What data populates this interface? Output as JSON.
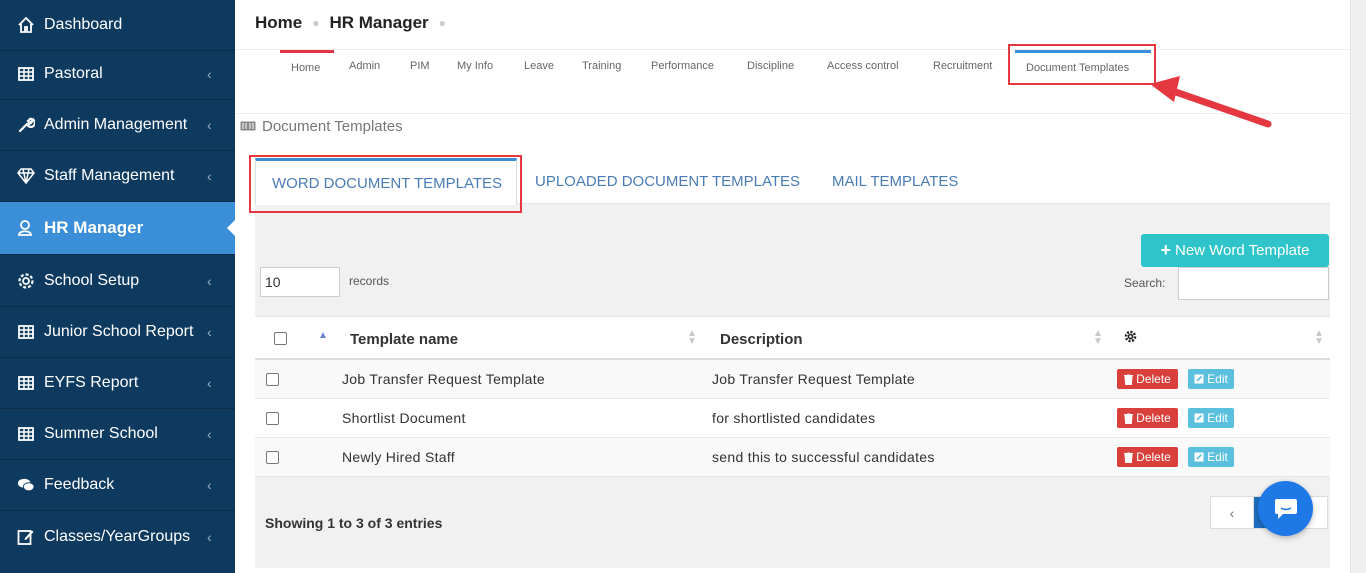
{
  "sidebar": {
    "items": [
      {
        "label": "Dashboard",
        "icon": "home-icon",
        "chevron": false
      },
      {
        "label": "Pastoral",
        "icon": "grid-icon",
        "chevron": true
      },
      {
        "label": "Admin Management",
        "icon": "wrench-icon",
        "chevron": true
      },
      {
        "label": "Staff Management",
        "icon": "diamond-icon",
        "chevron": true
      },
      {
        "label": "HR Manager",
        "icon": "user-hr-icon",
        "chevron": false,
        "active": true
      },
      {
        "label": "School Setup",
        "icon": "gear-icon",
        "chevron": true
      },
      {
        "label": "Junior School Report",
        "icon": "grid-icon",
        "chevron": true
      },
      {
        "label": "EYFS Report",
        "icon": "grid-icon",
        "chevron": true
      },
      {
        "label": "Summer School",
        "icon": "grid-icon",
        "chevron": true
      },
      {
        "label": "Feedback",
        "icon": "comments-icon",
        "chevron": true
      },
      {
        "label": "Classes/YearGroups",
        "icon": "edit-icon",
        "chevron": true
      }
    ]
  },
  "breadcrumb": {
    "home": "Home",
    "current": "HR Manager"
  },
  "topnav": {
    "items": [
      "Home",
      "Admin",
      "PIM",
      "My Info",
      "Leave",
      "Training",
      "Performance",
      "Discipline",
      "Access control",
      "Recruitment",
      "Document Templates"
    ]
  },
  "section": {
    "title": "Document Templates"
  },
  "tabs": [
    "WORD DOCUMENT TEMPLATES",
    "UPLOADED DOCUMENT TEMPLATES",
    "MAIL TEMPLATES"
  ],
  "toolbar": {
    "new_button": "New Word Template",
    "length_value": "10",
    "records_label": "records",
    "search_label": "Search:"
  },
  "table": {
    "columns": [
      "Template name",
      "Description"
    ],
    "rows": [
      {
        "name": "Job Transfer Request Template",
        "description": "Job Transfer Request Template"
      },
      {
        "name": "Shortlist Document",
        "description": "for shortlisted candidates"
      },
      {
        "name": "Newly Hired Staff",
        "description": "send this to successful candidates"
      }
    ],
    "delete_label": "Delete",
    "edit_label": "Edit"
  },
  "footer": {
    "showing": "Showing 1 to 3 of 3 entries"
  },
  "colors": {
    "sidebar": "#0f3a5f",
    "active": "#3a8fd8",
    "accent_teal": "#2ec4c9",
    "delete": "#d9403b",
    "edit": "#5bc0de",
    "annotation": "#e5373f"
  }
}
